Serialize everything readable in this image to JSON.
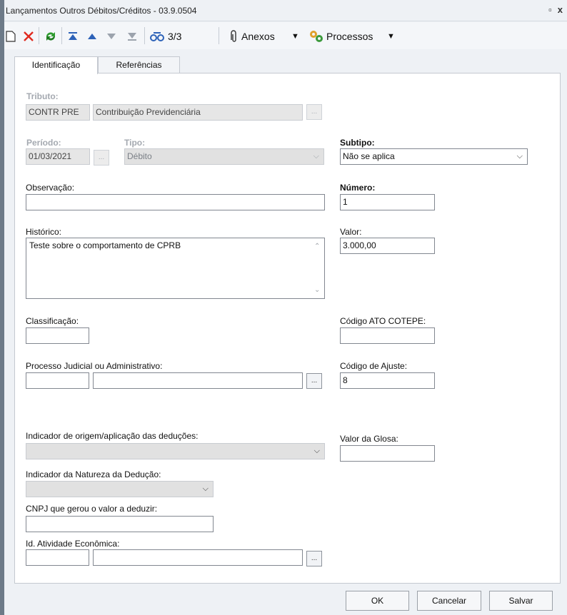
{
  "window": {
    "title": "Lançamentos Outros Débitos/Créditos - 03.9.0504",
    "restore_glyph": "▫",
    "close_glyph": "x"
  },
  "toolbar": {
    "counter": "3/3",
    "anexos": "Anexos",
    "processos": "Processos"
  },
  "tabs": [
    "Identificação",
    "Referências"
  ],
  "form": {
    "tributo_label": "Tributo:",
    "tributo_code": "CONTR PRE",
    "tributo_desc": "Contribuição Previdenciária",
    "periodo_label": "Período:",
    "periodo_value": "01/03/2021",
    "tipo_label": "Tipo:",
    "tipo_value": "Débito",
    "subtipo_label": "Subtipo:",
    "subtipo_value": "Não se aplica",
    "observacao_label": "Observação:",
    "observacao_value": "",
    "numero_label": "Número:",
    "numero_value": "1",
    "historico_label": "Histórico:",
    "historico_value": "Teste sobre o comportamento de CPRB",
    "valor_label": "Valor:",
    "valor_value": "3.000,00",
    "classificacao_label": "Classificação:",
    "classificacao_value": "",
    "cod_ato_label": "Código ATO COTEPE:",
    "cod_ato_value": "",
    "processo_label": "Processo Judicial ou Administrativo:",
    "processo_code": "",
    "processo_desc": "",
    "cod_ajuste_label": "Código de Ajuste:",
    "cod_ajuste_value": "8",
    "ind_origem_label": "Indicador de origem/aplicação das deduções:",
    "ind_origem_value": "",
    "valor_glosa_label": "Valor da Glosa:",
    "valor_glosa_value": "",
    "ind_natureza_label": "Indicador da Natureza da Dedução:",
    "ind_natureza_value": "",
    "cnpj_label": "CNPJ que gerou o valor a deduzir:",
    "cnpj_value": "",
    "atividade_label": "Id. Atividade Econômica:",
    "atividade_code": "",
    "atividade_desc": "",
    "dots": "..."
  },
  "footer": {
    "ok": "OK",
    "cancel": "Cancelar",
    "save": "Salvar"
  }
}
